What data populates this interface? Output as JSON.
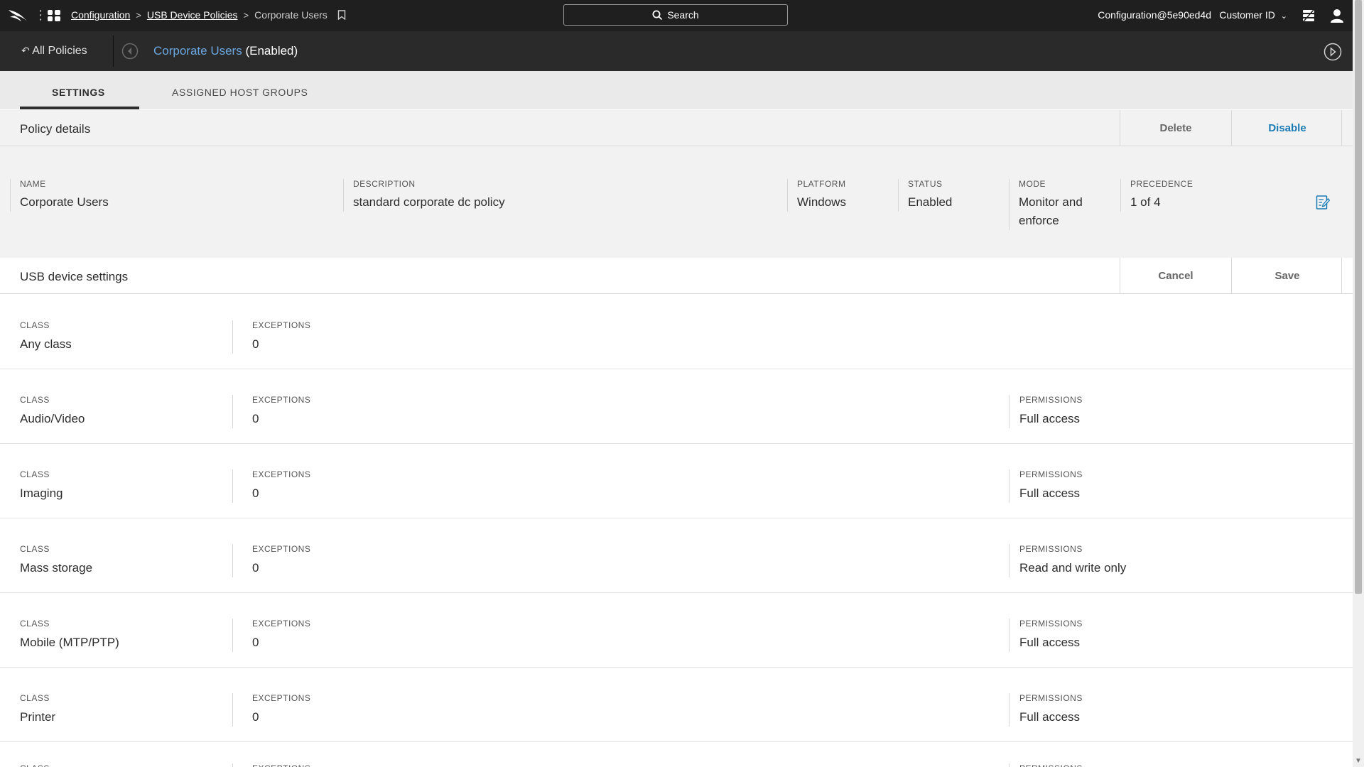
{
  "topbar": {
    "breadcrumb": [
      "Configuration",
      "USB Device Policies",
      "Corporate Users"
    ],
    "search_label": "Search",
    "user": "Configuration@5e90ed4d",
    "customer": "Customer ID"
  },
  "policy_header": {
    "back_label": "All Policies",
    "policy_name": "Corporate Users",
    "policy_status": "(Enabled)"
  },
  "tabs": [
    "SETTINGS",
    "ASSIGNED HOST GROUPS"
  ],
  "policy_details": {
    "title": "Policy details",
    "actions": [
      "Delete",
      "Disable"
    ],
    "fields": [
      {
        "label": "NAME",
        "value": "Corporate Users"
      },
      {
        "label": "DESCRIPTION",
        "value": "standard corporate dc policy"
      },
      {
        "label": "PLATFORM",
        "value": "Windows"
      },
      {
        "label": "STATUS",
        "value": "Enabled"
      },
      {
        "label": "MODE",
        "value": "Monitor and enforce"
      },
      {
        "label": "PRECEDENCE",
        "value": "1 of 4"
      }
    ]
  },
  "usb_settings": {
    "title": "USB device settings",
    "actions": [
      "Cancel",
      "Save"
    ],
    "labels": {
      "class": "CLASS",
      "exceptions": "EXCEPTIONS",
      "permissions": "PERMISSIONS"
    },
    "rows": [
      {
        "class": "Any class",
        "exceptions": "0",
        "permissions": ""
      },
      {
        "class": "Audio/Video",
        "exceptions": "0",
        "permissions": "Full access"
      },
      {
        "class": "Imaging",
        "exceptions": "0",
        "permissions": "Full access"
      },
      {
        "class": "Mass storage",
        "exceptions": "0",
        "permissions": "Read and write only"
      },
      {
        "class": "Mobile (MTP/PTP)",
        "exceptions": "0",
        "permissions": "Full access"
      },
      {
        "class": "Printer",
        "exceptions": "0",
        "permissions": "Full access"
      }
    ]
  }
}
